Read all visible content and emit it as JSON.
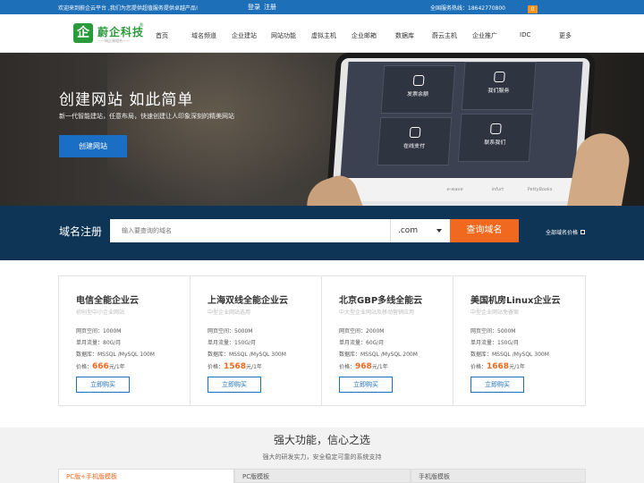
{
  "topbar": {
    "welcome": "欢迎来到蔚企云平台 ,我们为您提供超值服务提供卓越产品!",
    "login": "登录",
    "register": "注册",
    "hotline": "全国服务热线：18642770800",
    "cart_count": "0"
  },
  "header": {
    "logo_text": "蔚企科技",
    "logo_mark": "企",
    "logo_sub": "——网企易相合——",
    "logo_reg": "®",
    "nav": [
      "首页",
      "域名频道",
      "企业建站",
      "网站功能",
      "虚拟主机",
      "企业邮箱",
      "数据库",
      "蔚云主机",
      "企业推广",
      "IDC",
      "更多"
    ]
  },
  "banner": {
    "title": "创建网站 如此简单",
    "subtitle": "新一代智能建站，任意布局，快速创建让人印象深刻的精美网站",
    "button": "创建网站",
    "tiles": [
      "发票余额",
      "我们服务",
      "在线支付",
      "联系我们"
    ],
    "strip": [
      "e-wave",
      "infurt",
      "PettyBooks"
    ]
  },
  "domain": {
    "label": "域名注册",
    "placeholder": "输入要查询的域名",
    "suffix": ".com",
    "search_button": "查询域名",
    "all_prices": "全部域名价格"
  },
  "products": [
    {
      "title": "电信全能企业云",
      "desc": "初创型中小企业网站",
      "space": "网页空间：1000M",
      "traffic": "单月流量：80G/月",
      "db": "数据库：MSSQL /MySQL 100M",
      "price_label": "价格：",
      "price": "666",
      "unit": "元/1年",
      "button": "立即购买"
    },
    {
      "title": "上海双线全能企业云",
      "desc": "中型企业网站选用",
      "space": "网页空间：5000M",
      "traffic": "单月流量：150G/月",
      "db": "数据库：MSSQL /MySQL 300M",
      "price_label": "价格：",
      "price": "1568",
      "unit": "元/1年",
      "button": "立即购买"
    },
    {
      "title": "北京GBP多线全能云",
      "desc": "中大型企业网站及移动营销应用",
      "space": "网页空间：2000M",
      "traffic": "单月流量：60G/月",
      "db": "数据库：MSSQL /MySQL 200M",
      "price_label": "价格：",
      "price": "968",
      "unit": "元/1年",
      "button": "立即购买"
    },
    {
      "title": "美国机房Linux企业云",
      "desc": "中型企业网站免备案",
      "space": "网页空间：5000M",
      "traffic": "单月流量：150G/月",
      "db": "数据库：MSSQL /MySQL 300M",
      "price_label": "价格：",
      "price": "1668",
      "unit": "元/1年",
      "button": "立即购买"
    }
  ],
  "features": {
    "title": "强大功能，信心之选",
    "subtitle": "强大的研发实力，安全稳定可靠的系统支持",
    "tabs": [
      "PC版+手机版模板",
      "PC版模板",
      "手机版模板"
    ]
  },
  "colors": {
    "primary": "#1d6fb8",
    "accent": "#f0691f",
    "dark": "#0e3555"
  }
}
